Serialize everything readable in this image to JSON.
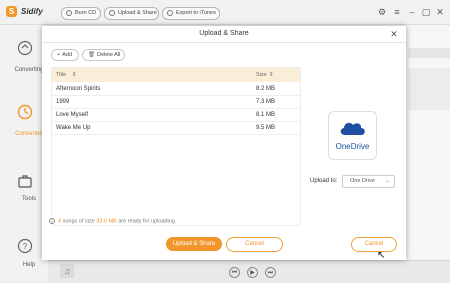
{
  "app": {
    "logo_letter": "S",
    "name": "Sidify"
  },
  "toolbar": {
    "burn_cd": "Burn CD",
    "upload_share": "Upload & Share",
    "export_itunes": "Export to iTunes"
  },
  "sidebar": {
    "items": [
      {
        "label": "Converting"
      },
      {
        "label": "Converted"
      },
      {
        "label": "Tools"
      },
      {
        "label": "Help"
      }
    ]
  },
  "dialog": {
    "title": "Upload & Share",
    "close_glyph": "✕",
    "add_label": "Add",
    "delete_all_label": "Delete All",
    "table": {
      "col_title": "Title",
      "col_size": "Size",
      "rows": [
        {
          "title": "Afternoon Spirits",
          "size": "8.2 MB"
        },
        {
          "title": "1999",
          "size": "7.3 MB"
        },
        {
          "title": "Love Myself",
          "size": "8.1 MB"
        },
        {
          "title": "Wake Me Up",
          "size": "9.5 MB"
        }
      ]
    },
    "service_name": "OneDrive",
    "upload_to_label": "Upload to:",
    "upload_to_value": "One Drive",
    "info": {
      "count": "4",
      "text_a": "songs of size",
      "size": "33.0 MB",
      "text_b": "are ready for uploading."
    },
    "upload_button": "Upload & Share",
    "cancel_button": "Cancel",
    "cancel_button_2": "Cancel"
  },
  "colors": {
    "accent": "#f0962a",
    "onedrive_blue": "#1d4fa3",
    "table_header": "#fbeed9"
  }
}
